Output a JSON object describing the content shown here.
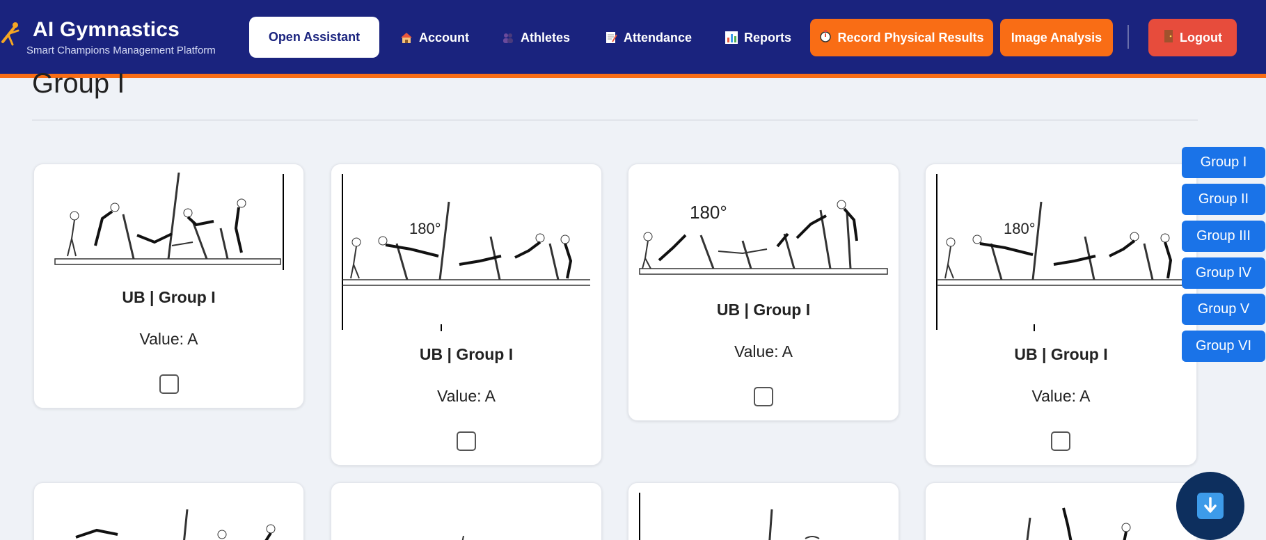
{
  "header": {
    "brand_title": "AI Gymnastics",
    "brand_subtitle": "Smart Champions Management Platform",
    "open_assistant": "Open Assistant",
    "nav": {
      "account": "Account",
      "athletes": "Athletes",
      "attendance": "Attendance",
      "reports": "Reports"
    },
    "record_physical_results": "Record Physical Results",
    "image_analysis": "Image Analysis",
    "logout": "Logout"
  },
  "page": {
    "heading": "Group I"
  },
  "cards": [
    {
      "title": "UB | Group I",
      "value": "Value: A",
      "checked": false
    },
    {
      "title": "UB | Group I",
      "value": "Value: A",
      "checked": false,
      "angle_label": "180°"
    },
    {
      "title": "UB | Group I",
      "value": "Value: A",
      "checked": false,
      "angle_label": "180°"
    },
    {
      "title": "UB | Group I",
      "value": "Value: A",
      "checked": false,
      "angle_label": "180°"
    }
  ],
  "side_nav": [
    "Group I",
    "Group II",
    "Group III",
    "Group IV",
    "Group V",
    "Group VI"
  ],
  "colors": {
    "header_bg": "#1a237e",
    "accent_orange": "#f96d15",
    "logout_red": "#e74c3c",
    "group_blue": "#1a73e8",
    "fab_bg": "#0d2f5e"
  },
  "icons": {
    "brand": "gymnast-icon",
    "account": "house-icon",
    "athletes": "people-icon",
    "attendance": "memo-icon",
    "reports": "bar-chart-icon",
    "record": "stopwatch-icon",
    "logout": "door-icon",
    "fab": "down-arrow-icon"
  }
}
